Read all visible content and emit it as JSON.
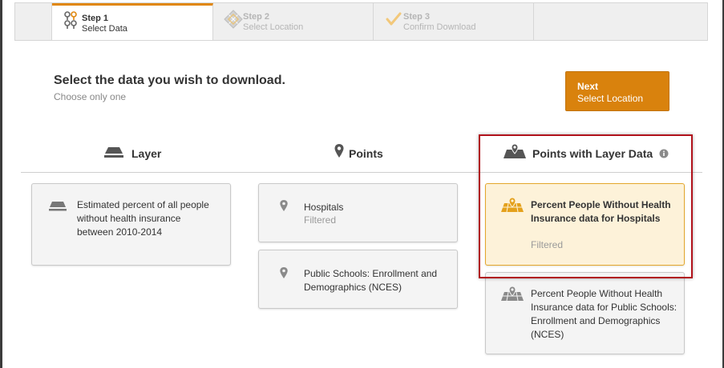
{
  "steps": [
    {
      "number": "Step 1",
      "name": "Select Data",
      "icon": "map-pins-icon",
      "active": true
    },
    {
      "number": "Step 2",
      "name": "Select Location",
      "icon": "map-grid-icon",
      "active": false
    },
    {
      "number": "Step 3",
      "name": "Confirm Download",
      "icon": "checkmark-icon",
      "active": false
    }
  ],
  "heading": "Select the data you wish to download.",
  "subheading": "Choose only one",
  "next_button": {
    "line1": "Next",
    "line2": "Select Location"
  },
  "columns": {
    "layer": {
      "label": "Layer",
      "icon": "layer-stack-icon",
      "cards": [
        {
          "title": "Estimated percent of all people without health insurance between 2010-2014"
        }
      ]
    },
    "points": {
      "label": "Points",
      "icon": "map-pin-icon",
      "cards": [
        {
          "title": "Hospitals",
          "subtitle": "Filtered"
        },
        {
          "title": "Public Schools: Enrollment and Demographics (NCES)"
        }
      ]
    },
    "points_layer": {
      "label": "Points with Layer Data",
      "icon": "map-pin-layer-icon",
      "info_icon": "info-icon",
      "cards": [
        {
          "title": "Percent People Without Health Insurance data for Hospitals",
          "subtitle": "Filtered",
          "selected": true
        },
        {
          "title": "Percent People Without Health Insurance data for Public Schools: Enrollment and Demographics (NCES)",
          "selected": false
        }
      ]
    }
  },
  "colors": {
    "accent": "#d9820d",
    "selected_bg": "#fdf2d9",
    "selected_border": "#e4a72c",
    "highlight_border": "#b1121b"
  }
}
